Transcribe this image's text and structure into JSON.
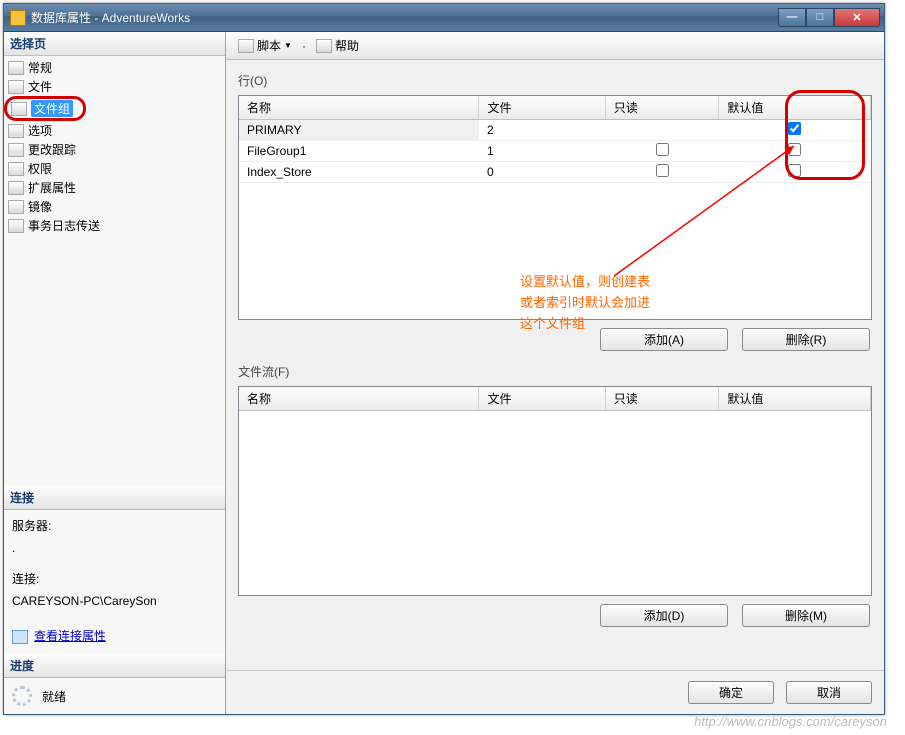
{
  "window": {
    "title": "数据库属性 - AdventureWorks"
  },
  "sidebar": {
    "select_header": "选择页",
    "items": [
      {
        "label": "常规"
      },
      {
        "label": "文件"
      },
      {
        "label": "文件组"
      },
      {
        "label": "选项"
      },
      {
        "label": "更改跟踪"
      },
      {
        "label": "权限"
      },
      {
        "label": "扩展属性"
      },
      {
        "label": "镜像"
      },
      {
        "label": "事务日志传送"
      }
    ],
    "conn_header": "连接",
    "server_label": "服务器:",
    "server_value": ".",
    "conn_label": "连接:",
    "conn_value": "CAREYSON-PC\\CareySon",
    "view_conn": "查看连接属性",
    "progress_header": "进度",
    "progress_value": "就绪"
  },
  "toolbar": {
    "script": "脚本",
    "help": "帮助"
  },
  "section1": {
    "label": "行(O)",
    "headers": {
      "name": "名称",
      "file": "文件",
      "ro": "只读",
      "def": "默认值"
    },
    "rows": [
      {
        "name": "PRIMARY",
        "file": "2",
        "ro": null,
        "def": true
      },
      {
        "name": "FileGroup1",
        "file": "1",
        "ro": false,
        "def": false
      },
      {
        "name": "Index_Store",
        "file": "0",
        "ro": false,
        "def": false
      }
    ],
    "add": "添加(A)",
    "remove": "删除(R)"
  },
  "section2": {
    "label": "文件流(F)",
    "headers": {
      "name": "名称",
      "file": "文件",
      "ro": "只读",
      "def": "默认值"
    },
    "add": "添加(D)",
    "remove": "删除(M)"
  },
  "footer": {
    "ok": "确定",
    "cancel": "取消"
  },
  "annotation": "设置默认值，则创建表或者索引时默认会加进这个文件组",
  "watermark": "http://www.cnblogs.com/careyson"
}
